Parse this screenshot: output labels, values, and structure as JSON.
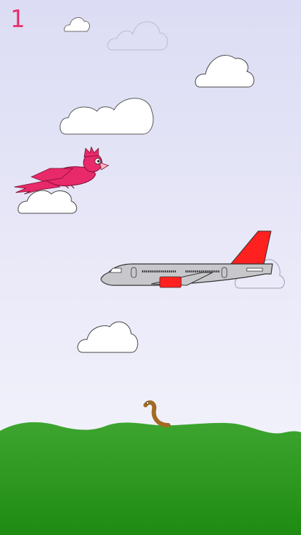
{
  "hud": {
    "score": "1"
  },
  "colors": {
    "sky_top": "#dcdcf4",
    "sky_bottom": "#f6f6fd",
    "grass_top": "#3da52f",
    "grass_bottom": "#1f8b12",
    "score": "#e9346e",
    "bird": "#e8296a",
    "plane_body": "#c8c8cc",
    "plane_accent": "#ff2020",
    "worm": "#a26a23",
    "cloud_fill": "#ffffff"
  },
  "sprites": {
    "player": "pink-bird",
    "obstacle": "airplane",
    "collectible": "worm"
  }
}
